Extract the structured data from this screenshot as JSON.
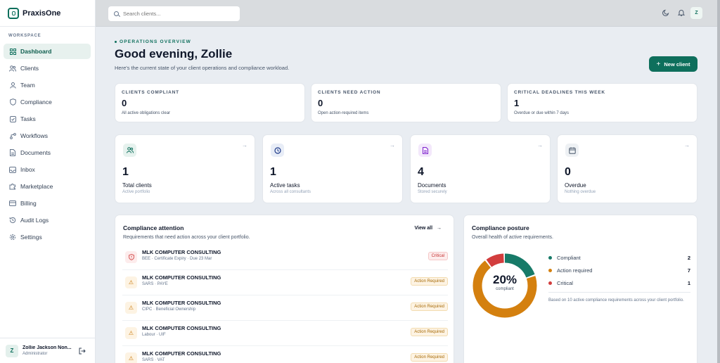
{
  "app": {
    "name": "PraxisOne"
  },
  "sidebar": {
    "section_label": "WORKSPACE",
    "items": [
      {
        "label": "Dashboard",
        "icon": "grid-icon",
        "active": true
      },
      {
        "label": "Clients",
        "icon": "users-icon"
      },
      {
        "label": "Team",
        "icon": "user-icon"
      },
      {
        "label": "Compliance",
        "icon": "shield-icon"
      },
      {
        "label": "Tasks",
        "icon": "checkbox-icon"
      },
      {
        "label": "Workflows",
        "icon": "workflow-icon"
      },
      {
        "label": "Documents",
        "icon": "document-icon"
      },
      {
        "label": "Inbox",
        "icon": "inbox-icon"
      },
      {
        "label": "Marketplace",
        "icon": "puzzle-icon"
      },
      {
        "label": "Billing",
        "icon": "card-icon"
      },
      {
        "label": "Audit Logs",
        "icon": "history-icon"
      },
      {
        "label": "Settings",
        "icon": "gear-icon"
      }
    ],
    "user": {
      "initial": "Z",
      "name": "Zollie Jackson Non...",
      "role": "Administrator"
    }
  },
  "topbar": {
    "search_placeholder": "Search clients...",
    "avatar_initial": "Z"
  },
  "header": {
    "eyebrow": "OPERATIONS OVERVIEW",
    "greeting": "Good evening, Zollie",
    "subtitle": "Here's the current state of your client operations and compliance workload.",
    "new_client_label": "New client"
  },
  "stats": [
    {
      "label": "CLIENTS COMPLIANT",
      "value": "0",
      "note": "All active obligations clear"
    },
    {
      "label": "CLIENTS NEED ACTION",
      "value": "0",
      "note": "Open action-required items"
    },
    {
      "label": "CRITICAL DEADLINES THIS WEEK",
      "value": "1",
      "note": "Overdue or due within 7 days"
    }
  ],
  "metrics": [
    {
      "value": "1",
      "label": "Total clients",
      "sub": "Active portfolio",
      "icon": "users-icon",
      "color": "#0e6f5c",
      "bg": "#e6f2ee"
    },
    {
      "value": "1",
      "label": "Active tasks",
      "sub": "Across all consultants",
      "icon": "clock-icon",
      "color": "#1e3a8a",
      "bg": "#e8edf7"
    },
    {
      "value": "4",
      "label": "Documents",
      "sub": "Stored securely",
      "icon": "document-icon",
      "color": "#7e22ce",
      "bg": "#f3e8fb"
    },
    {
      "value": "0",
      "label": "Overdue",
      "sub": "Nothing overdue",
      "icon": "calendar-icon",
      "color": "#475569",
      "bg": "#eef1f4"
    }
  ],
  "attention": {
    "title": "Compliance attention",
    "subtitle": "Requirements that need action across your client portfolio.",
    "view_all": "View all",
    "rows": [
      {
        "name": "MLK COMPUTER CONSULTING",
        "meta": "BEE · Certificate Expiry · Due 23 Mar",
        "badge": "Critical",
        "level": "critical"
      },
      {
        "name": "MLK COMPUTER CONSULTING",
        "meta": "SARS · PAYE",
        "badge": "Action Required",
        "level": "action"
      },
      {
        "name": "MLK COMPUTER CONSULTING",
        "meta": "CIPC · Beneficial Ownership",
        "badge": "Action Required",
        "level": "action"
      },
      {
        "name": "MLK COMPUTER CONSULTING",
        "meta": "Labour · UIF",
        "badge": "Action Required",
        "level": "action"
      },
      {
        "name": "MLK COMPUTER CONSULTING",
        "meta": "SARS · VAT",
        "badge": "Action Required",
        "level": "action"
      }
    ]
  },
  "posture": {
    "title": "Compliance posture",
    "subtitle": "Overall health of active requirements.",
    "percent": "20%",
    "percent_label": "compliant",
    "legend": [
      {
        "name": "Compliant",
        "value": 2,
        "color": "#177a68"
      },
      {
        "name": "Action required",
        "value": 7,
        "color": "#d4800f"
      },
      {
        "name": "Critical",
        "value": 1,
        "color": "#d23d3d"
      }
    ],
    "note": "Based on 10 active compliance requirements across your client portfolio."
  }
}
